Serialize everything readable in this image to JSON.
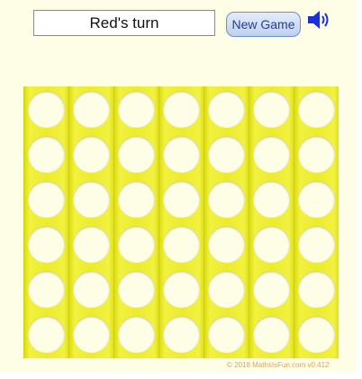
{
  "game": {
    "status_text": "Red's turn",
    "new_game_label": "New Game",
    "sound_icon": "speaker-volume-icon",
    "copyright": "© 2018 MathsIsFun.com v0.412"
  },
  "board": {
    "columns": 7,
    "rows": 6,
    "cells": [
      [
        "empty",
        "empty",
        "empty",
        "empty",
        "empty",
        "empty",
        "empty"
      ],
      [
        "empty",
        "empty",
        "empty",
        "empty",
        "empty",
        "empty",
        "empty"
      ],
      [
        "empty",
        "empty",
        "empty",
        "empty",
        "empty",
        "empty",
        "empty"
      ],
      [
        "empty",
        "empty",
        "empty",
        "empty",
        "empty",
        "empty",
        "empty"
      ],
      [
        "empty",
        "empty",
        "empty",
        "empty",
        "empty",
        "empty",
        "empty"
      ],
      [
        "empty",
        "empty",
        "empty",
        "empty",
        "empty",
        "empty",
        "empty"
      ]
    ]
  },
  "colors": {
    "background": "#fefee6",
    "board": "#e8e622",
    "accent_button": "#bfd0f0",
    "speaker": "#1a2fd6"
  }
}
